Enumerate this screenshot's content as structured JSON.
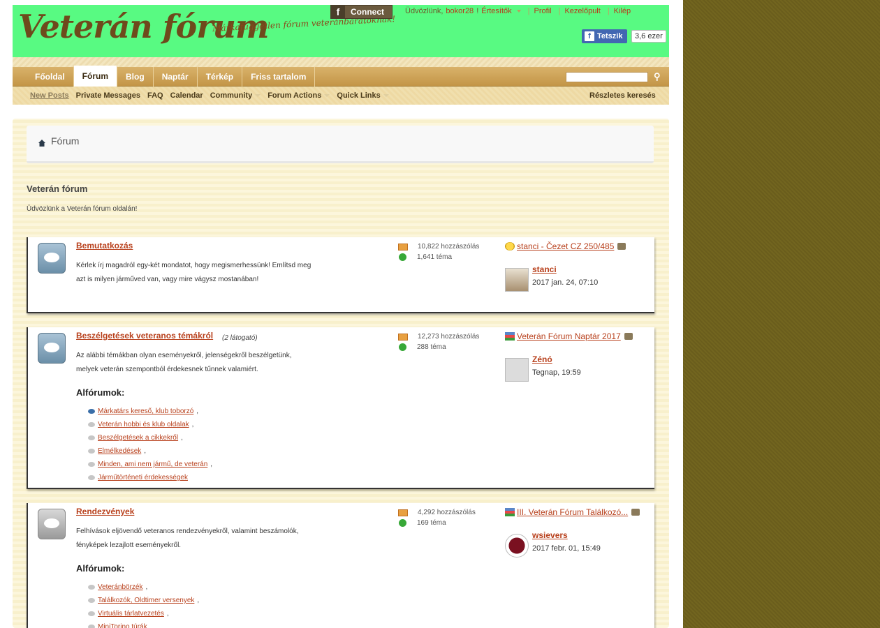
{
  "header": {
    "site_title": "Veterán fórum",
    "tagline": "Márkafüggetlen fórum veteránbarátoknak!",
    "fb_connect": "Connect",
    "welcome_prefix": "Üdvözlünk,",
    "username": "bokor28",
    "welcome_suffix": "!",
    "notifications": "Értesítők",
    "profile": "Profil",
    "control_panel": "Kezelőpult",
    "logout": "Kilép",
    "fb_like": "Tetszik",
    "fb_like_count": "3,6 ezer"
  },
  "nav": {
    "tabs": [
      "Főoldal",
      "Fórum",
      "Blog",
      "Naptár",
      "Térkép",
      "Friss tartalom"
    ],
    "active_tab": "Fórum",
    "sub": [
      "New Posts",
      "Private Messages",
      "FAQ",
      "Calendar",
      "Community",
      "Forum Actions",
      "Quick Links"
    ],
    "advanced_search": "Részletes keresés"
  },
  "breadcrumb": {
    "current": "Fórum"
  },
  "page": {
    "title": "Veterán fórum",
    "welcome": "Üdvözlünk a Veterán fórum oldalán!"
  },
  "subforums_heading": "Alfórumok:",
  "forums": [
    {
      "title": "Bemutatkozás",
      "viewing": "",
      "desc_line1": "Kérlek írj magadról egy-két mondatot, hogy megismerhessünk! Említsd meg",
      "desc_line2": "azt is milyen járműved van, vagy mire vágysz mostanában!",
      "posts": "10,822 hozzászólás",
      "threads": "1,641 téma",
      "last_title": "stanci - Čezet CZ 250/485",
      "last_user": "stanci",
      "last_date": "2017 jan. 24, 07:10"
    },
    {
      "title": "Beszélgetések veteranos témákról",
      "viewing": "(2 látogató)",
      "desc_line1": "Az alábbi témákban olyan eseményekről, jelenségekről beszélgetünk,",
      "desc_line2": "melyek veterán szempontból érdekesnek tűnnek valamiért.",
      "posts": "12,273 hozzászólás",
      "threads": "288 téma",
      "last_title": "Veterán Fórum Naptár 2017",
      "last_user": "Zénó",
      "last_date": "Tegnap, 19:59",
      "subforums": [
        "Márkatárs kereső, klub toborzó",
        "Veterán hobbi és klub oldalak",
        "Beszélgetések a cikkekről",
        "Elmélkedések",
        "Minden, ami nem jármű, de veterán",
        "Járműtörténeti érdekességek"
      ]
    },
    {
      "title": "Rendezvények",
      "viewing": "",
      "desc_line1": "Felhívások eljövendő veteranos rendezvényekről, valamint beszámolók,",
      "desc_line2": "fényképek lezajlott eseményekről.",
      "posts": "4,292 hozzászólás",
      "threads": "169 téma",
      "last_title": "III. Veterán Fórum Találkozó...",
      "last_user": "wsievers",
      "last_date": "2017 febr. 01, 15:49",
      "subforums": [
        "Veteránbörzék",
        "Találkozók, Oldtimer versenyek",
        "Virtuális tárlatvezetés",
        "MiniTorino túrák"
      ]
    }
  ],
  "colors": {
    "header_bg": "#58fa82",
    "nav_bg": "#c39547",
    "link": "#b8401c",
    "side_bg": "#6b5e1e"
  }
}
